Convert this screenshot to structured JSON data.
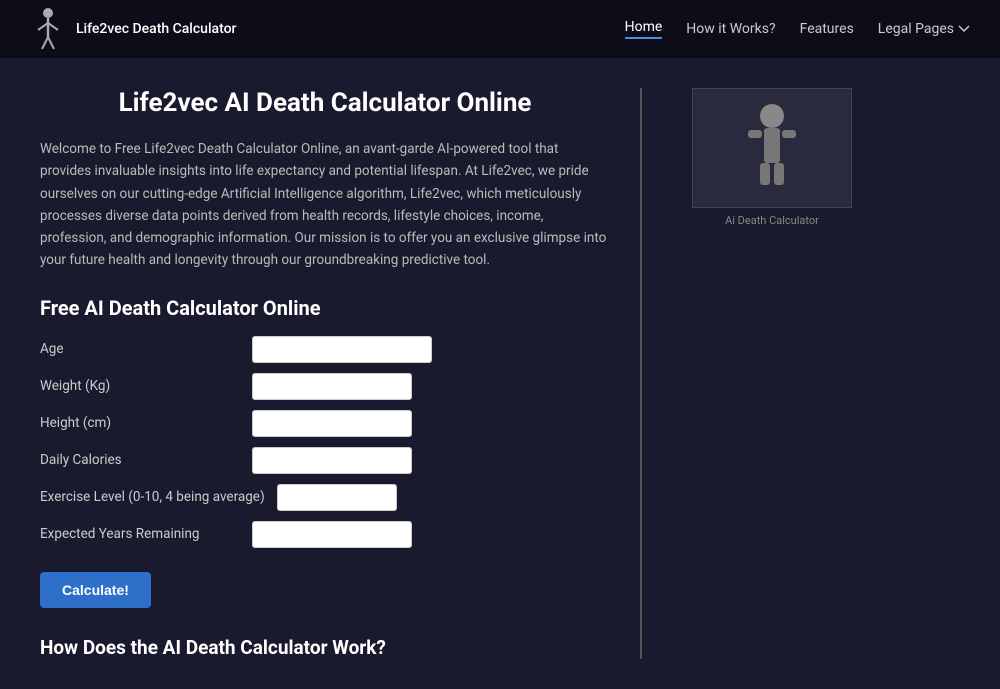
{
  "nav": {
    "brand_text": "Life2vec Death Calculator",
    "links": [
      {
        "label": "Home",
        "active": true
      },
      {
        "label": "How it Works?",
        "active": false
      },
      {
        "label": "Features",
        "active": false
      },
      {
        "label": "Legal Pages",
        "dropdown": true,
        "active": false
      }
    ]
  },
  "page": {
    "title": "Life2vec AI Death Calculator Online",
    "description": "Welcome to Free Life2vec Death Calculator Online, an avant-garde AI-powered tool that provides invaluable insights into life expectancy and potential lifespan. At Life2vec, we pride ourselves on our cutting-edge Artificial Intelligence algorithm, Life2vec, which meticulously processes diverse data points derived from health records, lifestyle choices, income, profession, and demographic information. Our mission is to offer you an exclusive glimpse into your future health and longevity through our groundbreaking predictive tool.",
    "form_title": "Free AI Death Calculator Online",
    "fields": [
      {
        "label": "Age",
        "name": "age-input",
        "value": ""
      },
      {
        "label": "Weight (Kg)",
        "name": "weight-input",
        "value": ""
      },
      {
        "label": "Height (cm)",
        "name": "height-input",
        "value": ""
      },
      {
        "label": "Daily Calories",
        "name": "calories-input",
        "value": ""
      },
      {
        "label": "Exercise Level (0-10, 4 being average)",
        "name": "exercise-input",
        "value": ""
      },
      {
        "label": "Expected Years Remaining",
        "name": "years-remaining-input",
        "value": ""
      }
    ],
    "calculate_btn": "Calculate!",
    "section_bottom_title": "How Does the AI Death Calculator Work?"
  },
  "sidebar": {
    "image_label": "Ai Death Calculator"
  }
}
